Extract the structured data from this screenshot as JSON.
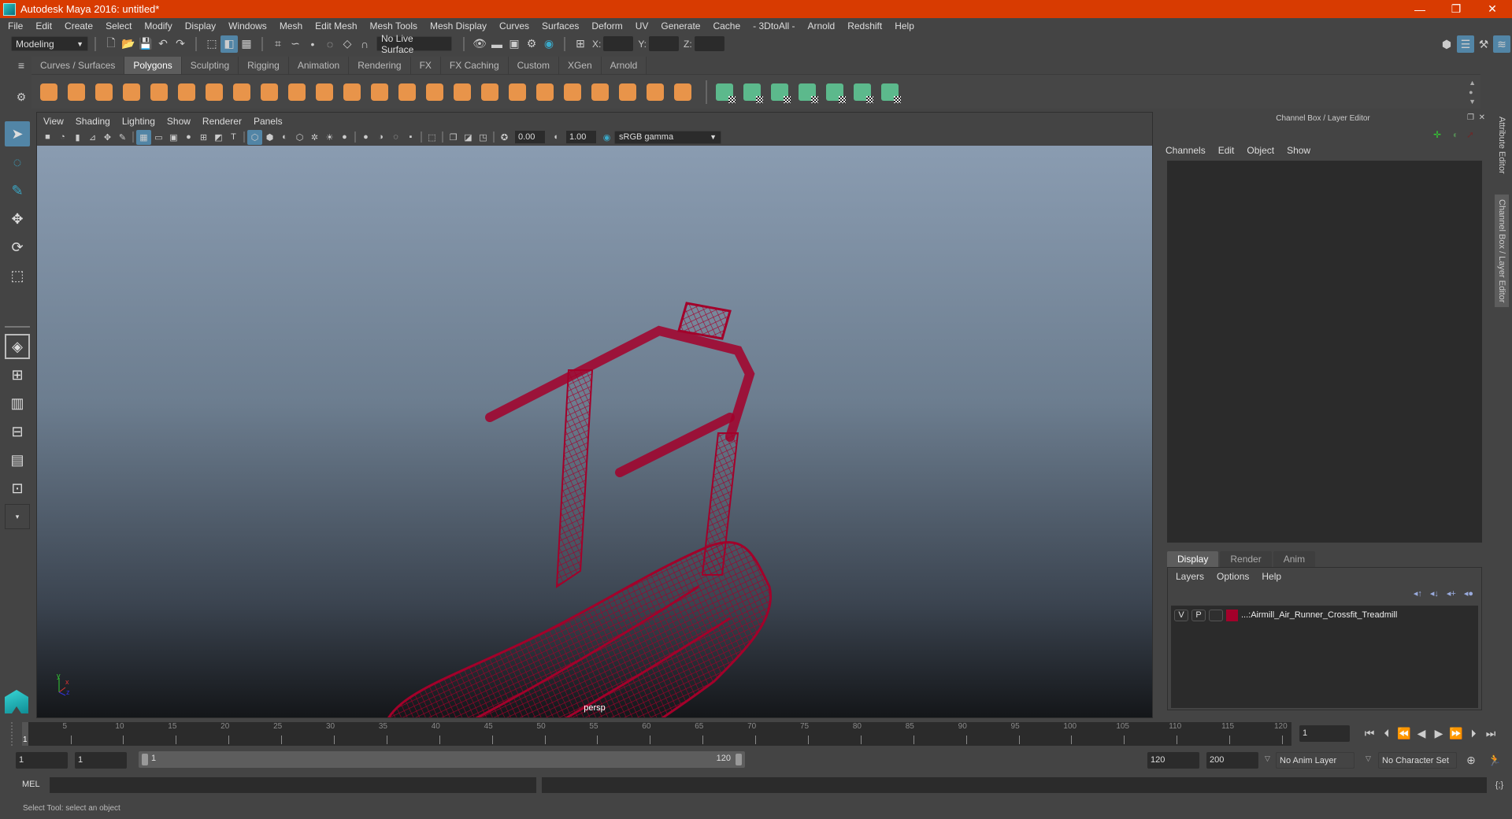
{
  "window": {
    "title": "Autodesk Maya 2016: untitled*",
    "controls": {
      "minimize": "—",
      "restore": "❐",
      "close": "✕"
    }
  },
  "menubar": [
    "File",
    "Edit",
    "Create",
    "Select",
    "Modify",
    "Display",
    "Windows",
    "Mesh",
    "Edit Mesh",
    "Mesh Tools",
    "Mesh Display",
    "Curves",
    "Surfaces",
    "Deform",
    "UV",
    "Generate",
    "Cache",
    "- 3DtoAll -",
    "Arnold",
    "Redshift",
    "Help"
  ],
  "statusline": {
    "mode": "Modeling",
    "live_surface": "No Live Surface",
    "x_label": "X:",
    "y_label": "Y:",
    "z_label": "Z:"
  },
  "shelf": {
    "tabs": [
      "Curves / Surfaces",
      "Polygons",
      "Sculpting",
      "Rigging",
      "Animation",
      "Rendering",
      "FX",
      "FX Caching",
      "Custom",
      "XGen",
      "Arnold"
    ],
    "active_tab": "Polygons",
    "orange_icons": [
      "poly-sphere",
      "poly-cube",
      "poly-cylinder",
      "poly-cone",
      "poly-plane",
      "poly-torus",
      "poly-pyramid",
      "poly-pipe",
      "combine",
      "separate",
      "mirror",
      "smooth",
      "extrude-face",
      "bevel",
      "bridge",
      "append",
      "multi-cut",
      "insert-edge-loop",
      "bevel-edge",
      "target-weld",
      "merge",
      "slide-edge",
      "flip-triangle",
      "extract"
    ],
    "green_icons": [
      "planar-uv",
      "cylindrical-uv",
      "spherical-uv",
      "automatic-uv",
      "unfold-uv",
      "uv-editor",
      "layout-uv"
    ]
  },
  "toolbox": [
    "select-tool",
    "lasso-tool",
    "paint-select-tool",
    "move-tool",
    "rotate-tool",
    "scale-tool"
  ],
  "viewport": {
    "menu": [
      "View",
      "Shading",
      "Lighting",
      "Show",
      "Renderer",
      "Panels"
    ],
    "exposure": "0.00",
    "gamma": "1.00",
    "color_space": "sRGB gamma",
    "camera_label": "persp",
    "axis": {
      "x": "x",
      "y": "y",
      "z": "z"
    },
    "wireframe_color": "#a3002a"
  },
  "channel_box": {
    "title": "Channel Box / Layer Editor",
    "menu": [
      "Channels",
      "Edit",
      "Object",
      "Show"
    ],
    "layer_tabs": [
      "Display",
      "Render",
      "Anim"
    ],
    "active_layer_tab": "Display",
    "layer_menu": [
      "Layers",
      "Options",
      "Help"
    ],
    "layers": [
      {
        "visible": "V",
        "playback": "P",
        "color": "#a3002a",
        "name": "...:Airmill_Air_Runner_Crossfit_Treadmill"
      }
    ]
  },
  "side_tabs": [
    "Attribute Editor",
    "Channel Box / Layer Editor"
  ],
  "timeline": {
    "ticks": [
      5,
      10,
      15,
      20,
      25,
      30,
      35,
      40,
      45,
      50,
      55,
      60,
      65,
      70,
      75,
      80,
      85,
      90,
      95,
      100,
      105,
      110,
      115,
      120
    ],
    "current_frame": "1",
    "range_min": 1,
    "range_max": 120
  },
  "range": {
    "start": "1",
    "playback_start": "1",
    "slider_start": "1",
    "slider_end": "120",
    "playback_end": "120",
    "end": "200",
    "anim_layer": "No Anim Layer",
    "character_set": "No Character Set"
  },
  "command_line": {
    "label": "MEL",
    "value": ""
  },
  "help_line": "Select Tool: select an object"
}
